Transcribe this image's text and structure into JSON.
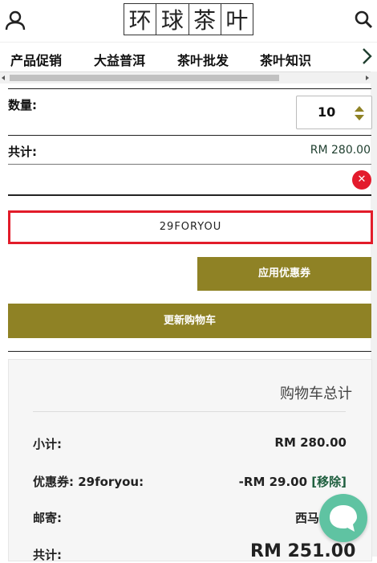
{
  "header": {
    "logo_chars": [
      "环",
      "球",
      "茶",
      "叶"
    ]
  },
  "nav": {
    "items": [
      "产品促销",
      "大益普洱",
      "茶叶批发",
      "茶叶知识"
    ]
  },
  "cart": {
    "quantity_label": "数量:",
    "quantity_value": "10",
    "total_label": "共计:",
    "total_value": "RM 280.00",
    "coupon_code": "29FORYOU",
    "apply_coupon_label": "应用优惠券",
    "update_cart_label": "更新购物车"
  },
  "totals": {
    "title": "购物车总计",
    "subtotal_label": "小计:",
    "subtotal_value": "RM 280.00",
    "coupon_label": "优惠券: 29foryou:",
    "coupon_value": "-RM 29.00",
    "coupon_remove": "[移除]",
    "shipping_label": "邮寄:",
    "shipping_value": "西马",
    "grand_label": "共计:",
    "grand_value": "RM 251.00"
  },
  "colors": {
    "accent": "#8f8225",
    "highlight": "#e21c2a",
    "chat": "#5fc3a2"
  }
}
